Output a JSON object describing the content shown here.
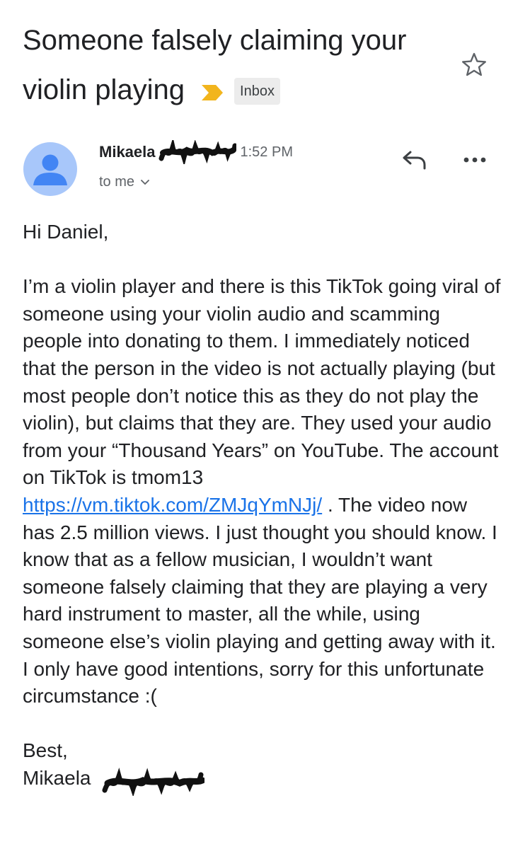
{
  "email": {
    "subject_line1": "Someone falsely claiming your",
    "subject_line2": "violin playing",
    "label_badge": "Inbox",
    "sender_name": "Mikaela",
    "time": "1:52 PM",
    "recipient": "to me",
    "greeting": "Hi Daniel,",
    "body_before_link": "I’m a violin player and there is this TikTok going viral of someone using your violin audio and scamming people into donating to them. I immediately noticed that the person in the video is not actually playing (but most people don’t notice this as they do not play the violin), but claims that they are. They used your audio from your “Thousand Years” on YouTube. The account on TikTok is tmom13",
    "link_text": "https://vm.tiktok.com/ZMJqYmNJj/",
    "body_after_link": " . The video now has 2.5 million views. I just thought you should know. I know that as a fellow musician, I wouldn’t want someone falsely claiming that they are playing a very hard instrument to master, all the while, using someone else’s violin playing and getting away with it. I only have good intentions, sorry for this unfortunate circumstance :(",
    "signoff": "Best,",
    "signature_name": "Mikaela"
  },
  "icons": {
    "importance": "importance-marker-icon",
    "star": "star-outline-icon",
    "avatar": "person-avatar-icon",
    "reply": "reply-arrow-icon",
    "more": "more-horizontal-icon",
    "chevron": "chevron-down-icon"
  },
  "colors": {
    "importance_yellow": "#f2b51d",
    "link_blue": "#1a73e8",
    "avatar_bg": "#a8c7fa",
    "avatar_fg": "#4285f4",
    "badge_bg": "#ececec",
    "secondary_text": "#5f6368"
  }
}
